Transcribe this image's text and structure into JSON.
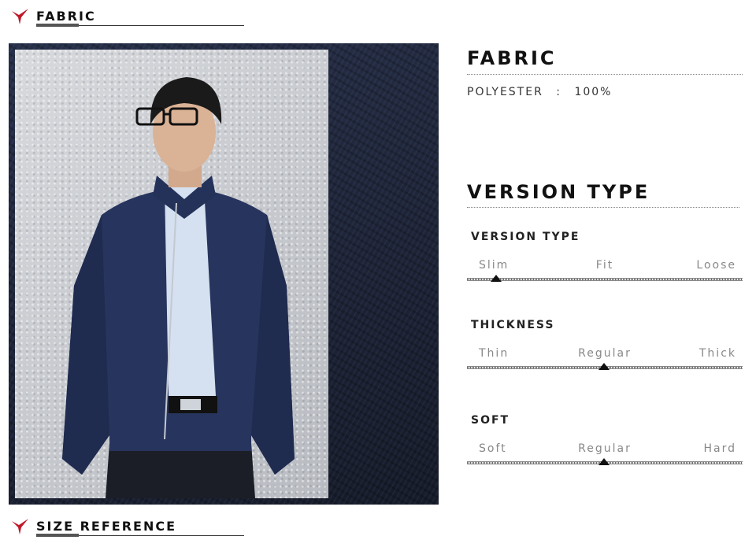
{
  "header": {
    "fabric_title": "FABRIC"
  },
  "footer": {
    "size_reference_title": "SIZE REFERENCE"
  },
  "brand": {
    "accent_color": "#c0182a"
  },
  "fabric": {
    "heading": "FABRIC",
    "material": "POLYESTER",
    "separator": ":",
    "percent": "100%"
  },
  "version": {
    "heading": "VERSION TYPE",
    "scales": [
      {
        "label": "VERSION TYPE",
        "options": [
          "Slim",
          "Fit",
          "Loose"
        ],
        "selected": "Slim"
      },
      {
        "label": "THICKNESS",
        "options": [
          "Thin",
          "Regular",
          "Thick"
        ],
        "selected": "Regular"
      },
      {
        "label": "SOFT",
        "options": [
          "Soft",
          "Regular",
          "Hard"
        ],
        "selected": "Regular"
      }
    ]
  }
}
